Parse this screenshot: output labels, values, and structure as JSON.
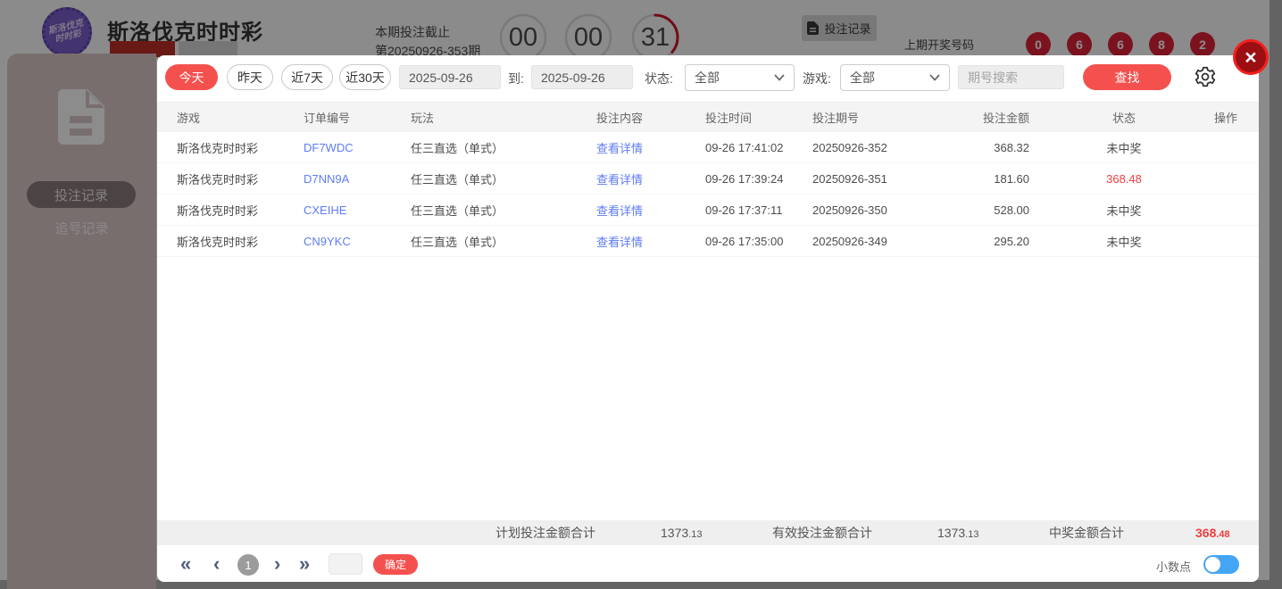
{
  "header": {
    "logo": {
      "line1": "斯洛伐克",
      "line2": "时时彩"
    },
    "title": "斯洛伐克时时彩",
    "deadline_label": "本期投注截止",
    "current_period": "第20250926-353期",
    "countdown": {
      "hours": "00",
      "minutes": "00",
      "seconds": "31"
    },
    "record_button": "投注记录",
    "last_draw_label": "上期开奖号码",
    "last_draw_numbers": [
      "0",
      "6",
      "6",
      "8",
      "2"
    ]
  },
  "sidebar": {
    "items": [
      {
        "label": "投注记录",
        "active": true
      },
      {
        "label": "追号记录",
        "active": false
      }
    ]
  },
  "modal": {
    "close_glyph": "×",
    "filters": {
      "quick": [
        "今天",
        "昨天",
        "近7天",
        "近30天"
      ],
      "date_from": "2025-09-26",
      "to_label": "到:",
      "date_to": "2025-09-26",
      "status_label": "状态:",
      "status_value": "全部",
      "game_label": "游戏:",
      "game_value": "全部",
      "search_placeholder": "期号搜索",
      "search_button": "查找"
    },
    "table": {
      "headers": [
        "游戏",
        "订单编号",
        "玩法",
        "投注内容",
        "投注时间",
        "投注期号",
        "投注金额",
        "状态",
        "操作"
      ],
      "rows": [
        {
          "game": "斯洛伐克时时彩",
          "order_id": "DF7WDC",
          "play": "任三直选（单式）",
          "detail_link": "查看详情",
          "time": "09-26 17:41:02",
          "period": "20250926-352",
          "amount": "368.32",
          "status": "未中奖"
        },
        {
          "game": "斯洛伐克时时彩",
          "order_id": "D7NN9A",
          "play": "任三直选（单式）",
          "detail_link": "查看详情",
          "time": "09-26 17:39:24",
          "period": "20250926-351",
          "amount": "181.60",
          "status": "368.48"
        },
        {
          "game": "斯洛伐克时时彩",
          "order_id": "CXEIHE",
          "play": "任三直选（单式）",
          "detail_link": "查看详情",
          "time": "09-26 17:37:11",
          "period": "20250926-350",
          "amount": "528.00",
          "status": "未中奖"
        },
        {
          "game": "斯洛伐克时时彩",
          "order_id": "CN9YKC",
          "play": "任三直选（单式）",
          "detail_link": "查看详情",
          "time": "09-26 17:35:00",
          "period": "20250926-349",
          "amount": "295.20",
          "status": "未中奖"
        }
      ]
    },
    "summary": {
      "planned_label": "计划投注金额合计",
      "planned_int": "1373",
      "planned_dec": ".13",
      "valid_label": "有效投注金额合计",
      "valid_int": "1373",
      "valid_dec": ".13",
      "win_label": "中奖金额合计",
      "win_int": "368",
      "win_dec": ".48"
    },
    "pagination": {
      "first_icon": "«",
      "prev_icon": "‹",
      "page": "1",
      "next_icon": "›",
      "last_icon": "»",
      "confirm_button": "确定",
      "decimal_label": "小数点"
    }
  },
  "colors": {
    "accent_red": "#f4514e",
    "link_blue": "#5e7cf2",
    "win_red": "#f03e3e",
    "toggle_blue": "#45a5f5",
    "ball_red": "#e0243a",
    "logo_purple": "#7a5ec9"
  }
}
